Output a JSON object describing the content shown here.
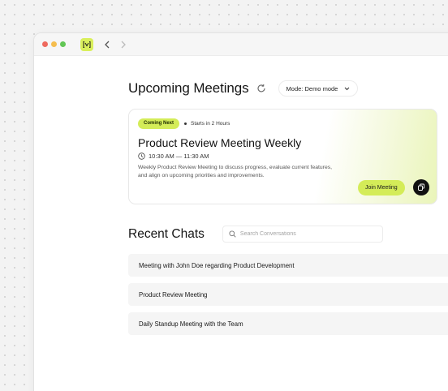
{
  "window": {
    "nav_back_icon": "chevron-left-icon",
    "nav_forward_icon": "chevron-right-icon",
    "logo_color": "#d9ef5b"
  },
  "upcoming": {
    "title": "Upcoming Meetings",
    "refresh_icon": "refresh-icon",
    "mode_label": "Mode: Demo mode"
  },
  "meeting": {
    "badge": "Coming Next",
    "starts": "Starts in 2 Hours",
    "title": "Product Review Meeting Weekly",
    "time": "10:30 AM — 11:30 AM",
    "description": "Weekly Product Review Meeting to discuss progress, evaluate current features, and align on upcoming priorities and improvements.",
    "join_label": "Join Meeting",
    "accent": "#d4ec58"
  },
  "recent": {
    "title": "Recent Chats",
    "search_placeholder": "Search Conversations",
    "chats": [
      "Meeting with John Doe regarding Product Development",
      "Product Review Meeting",
      "Daily Standup Meeting with the Team"
    ]
  }
}
